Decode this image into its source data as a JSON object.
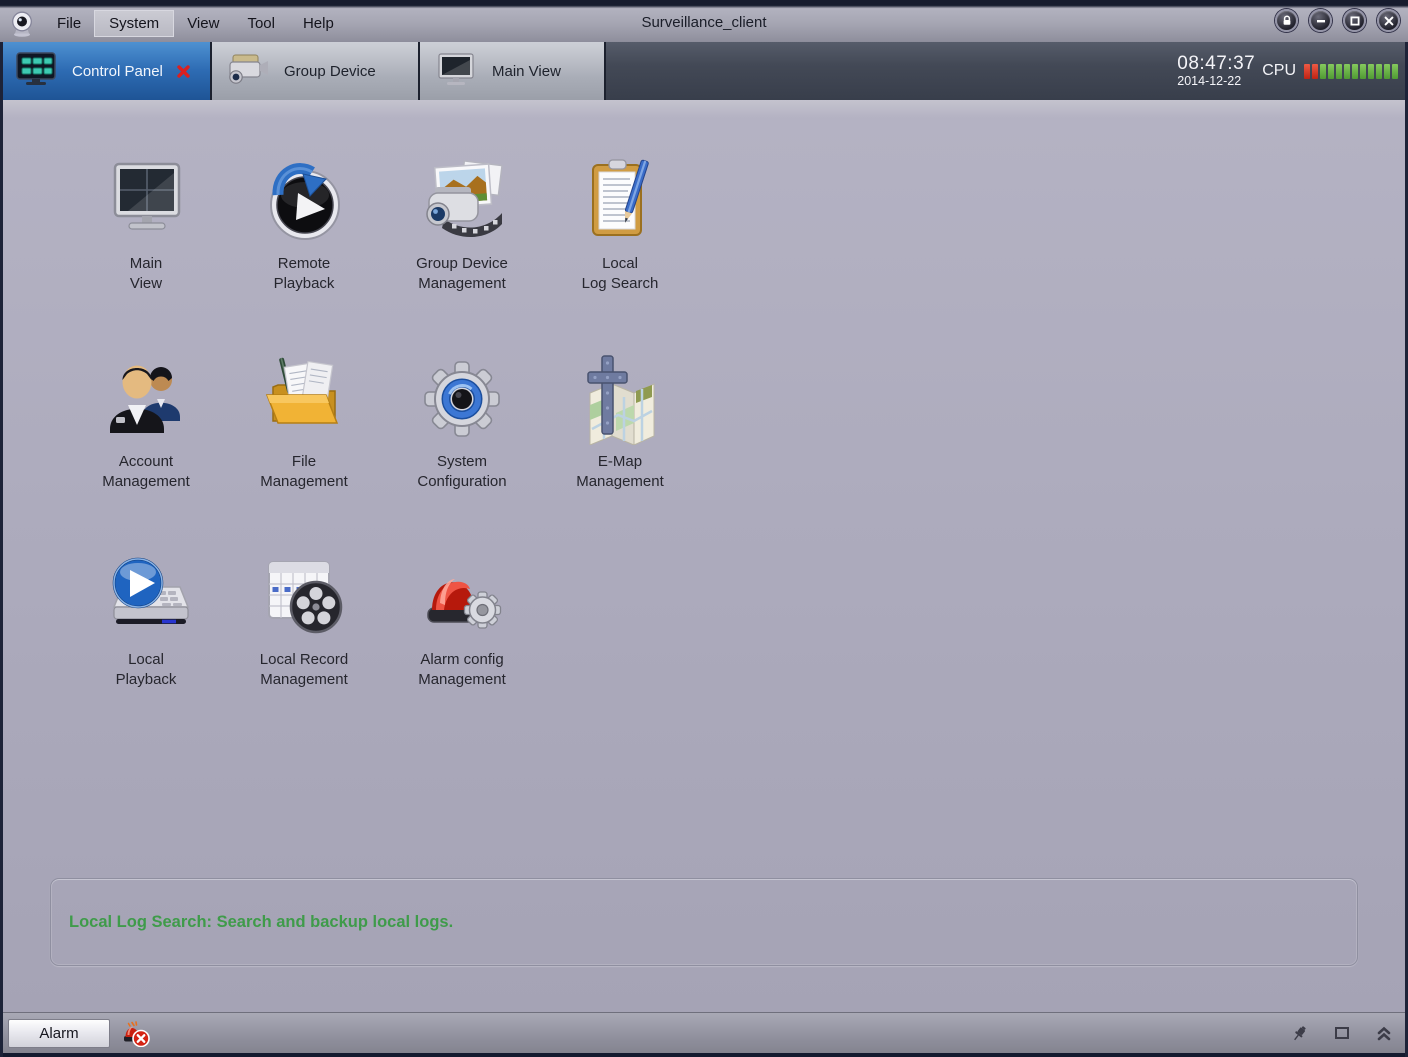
{
  "window": {
    "title": "Surveillance_client",
    "menu": [
      "File",
      "System",
      "View",
      "Tool",
      "Help"
    ],
    "highlighted_menu": "System"
  },
  "tabs": {
    "control_panel": "Control Panel",
    "group_device": "Group Device",
    "main_view": "Main View"
  },
  "status": {
    "time": "08:47:37",
    "date": "2014-12-22",
    "cpu_label": "CPU",
    "cpu_red_segments": 2,
    "cpu_green_segments": 10
  },
  "control_panel": {
    "items": [
      {
        "icon": "main-view-icon",
        "line1": "Main",
        "line2": "View"
      },
      {
        "icon": "remote-playback-icon",
        "line1": "Remote",
        "line2": "Playback"
      },
      {
        "icon": "group-device-management-icon",
        "line1": "Group Device",
        "line2": "Management"
      },
      {
        "icon": "local-log-search-icon",
        "line1": "Local",
        "line2": "Log Search"
      },
      {
        "icon": "account-management-icon",
        "line1": "Account",
        "line2": "Management"
      },
      {
        "icon": "file-management-icon",
        "line1": "File",
        "line2": "Management"
      },
      {
        "icon": "system-configuration-icon",
        "line1": "System",
        "line2": "Configuration"
      },
      {
        "icon": "e-map-management-icon",
        "line1": "E-Map",
        "line2": "Management"
      },
      {
        "icon": "local-playback-icon",
        "line1": "Local",
        "line2": "Playback"
      },
      {
        "icon": "local-record-management-icon",
        "line1": "Local Record",
        "line2": "Management"
      },
      {
        "icon": "alarm-config-management-icon",
        "line1": "Alarm config",
        "line2": "Management"
      }
    ]
  },
  "info_box": {
    "text": "Local Log Search: Search and backup local logs."
  },
  "bottom_bar": {
    "alarm_label": "Alarm"
  },
  "colors": {
    "active_tab_blue": "#2e6cb4",
    "info_text_green": "#3f9b4a",
    "cpu_red": "#d93a2b",
    "cpu_green": "#66b342"
  }
}
